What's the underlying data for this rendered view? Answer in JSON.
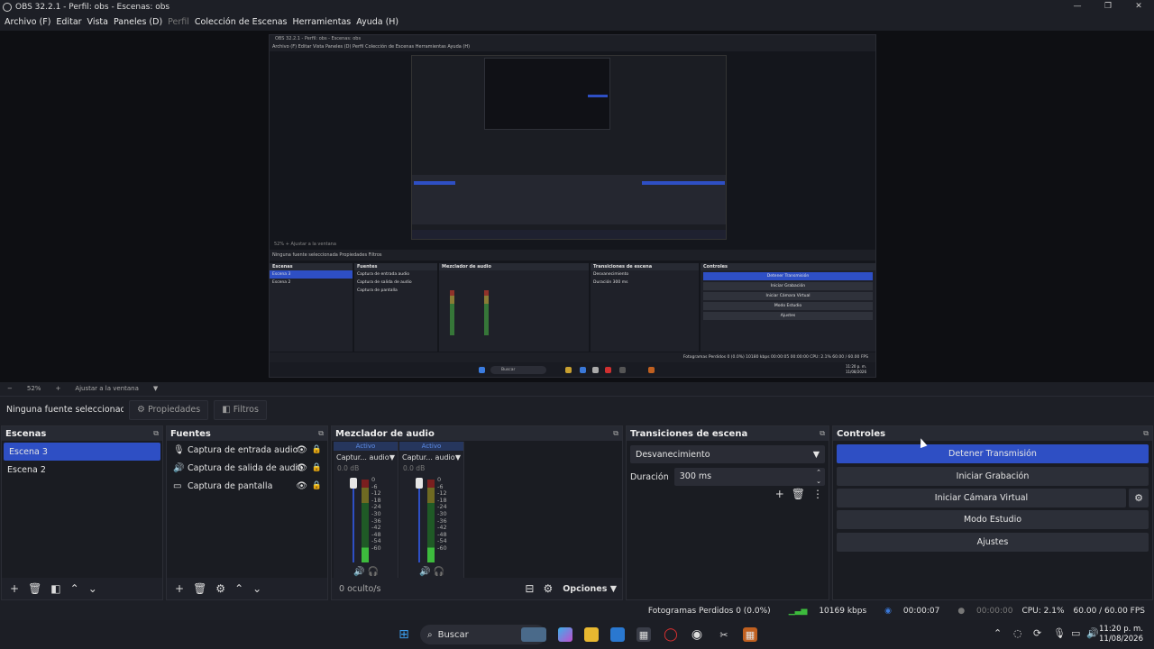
{
  "window": {
    "title": "OBS 32.2.1 - Perfil: obs - Escenas: obs",
    "minimize": "—",
    "maximize": "❐",
    "close": "✕"
  },
  "menu": {
    "items": [
      "Archivo (F)",
      "Editar",
      "Vista",
      "Paneles (D)",
      "Perfil",
      "Colección de Escenas",
      "Herramientas",
      "Ayuda (H)"
    ]
  },
  "preview_mini": {
    "title": "OBS 32.2.1 - Perfil: obs - Escenas: obs",
    "menu": "Archivo (F)   Editar   Vista   Paneles (D)   Perfil   Colección de Escenas   Herramientas   Ayuda (H)",
    "zoom": "52%   +   Ajustar a la ventana",
    "props": "Ninguna fuente seleccionada      Propiedades      Filtros",
    "dock_titles": [
      "Escenas",
      "Fuentes",
      "Mezclador de audio",
      "Transiciones de escena",
      "Controles"
    ],
    "scenes": [
      "Escena 3",
      "Escena 2"
    ],
    "sources": [
      "Captura de entrada audio",
      "Captura de salida de audio",
      "Captura de pantalla"
    ],
    "transition": "Desvanecimiento",
    "duration": "Duración   300 ms",
    "controls": [
      "Detener Transmisión",
      "Iniciar Grabación",
      "Iniciar Cámara Virtual",
      "Modo Estudio",
      "Ajustes"
    ],
    "status": "Fotogramas Perdidos 0 (0.0%)   10180 kbps   00:00:05   00:00:00   CPU: 2.1%   60.00 / 60.00 FPS",
    "search": "Buscar",
    "clock_time": "11:20 p. m.",
    "clock_date": "11/08/2026"
  },
  "zoombar": {
    "minus": "−",
    "zoom": "52%",
    "plus": "+",
    "fit": "Ajustar a la ventana",
    "arrow": "▼"
  },
  "props": {
    "no_source": "Ninguna fuente seleccionada",
    "properties": "Propiedades",
    "filters": "Filtros"
  },
  "scenes": {
    "title": "Escenas",
    "items": [
      "Escena 3",
      "Escena 2"
    ]
  },
  "sources": {
    "title": "Fuentes",
    "items": [
      {
        "label": "Captura de entrada audio",
        "icon": "mic-icon"
      },
      {
        "label": "Captura de salida de audio",
        "icon": "speaker-icon"
      },
      {
        "label": "Captura de pantalla",
        "icon": "monitor-icon"
      }
    ]
  },
  "mixer": {
    "title": "Mezclador de audio",
    "channels": [
      {
        "active": "Activo",
        "name": "Captur... audio",
        "db": "0.0 dB"
      },
      {
        "active": "Activo",
        "name": "Captur... audio",
        "db": "0.0 dB"
      }
    ],
    "scale": [
      "0",
      "-6",
      "-12",
      "-18",
      "-24",
      "-30",
      "-36",
      "-42",
      "-48",
      "-54",
      "-60"
    ],
    "hidden": "0 oculto/s",
    "options": "Opciones"
  },
  "transitions": {
    "title": "Transiciones de escena",
    "selected": "Desvanecimiento",
    "duration_label": "Duración",
    "duration_value": "300 ms"
  },
  "controls": {
    "title": "Controles",
    "stop_stream": "Detener Transmisión",
    "start_recording": "Iniciar Grabación",
    "start_virtualcam": "Iniciar Cámara Virtual",
    "studio_mode": "Modo Estudio",
    "settings": "Ajustes"
  },
  "status": {
    "dropped": "Fotogramas Perdidos 0 (0.0%)",
    "bitrate": "10169 kbps",
    "stream_time": "00:00:07",
    "rec_time": "00:00:00",
    "cpu": "CPU: 2.1%",
    "fps": "60.00 / 60.00 FPS"
  },
  "taskbar": {
    "search": "Buscar",
    "time": "11:20 p. m.",
    "date": "11/08/2026"
  },
  "colors": {
    "accent": "#2e4fc4",
    "panel": "#1a1c22",
    "header": "#272a33"
  }
}
